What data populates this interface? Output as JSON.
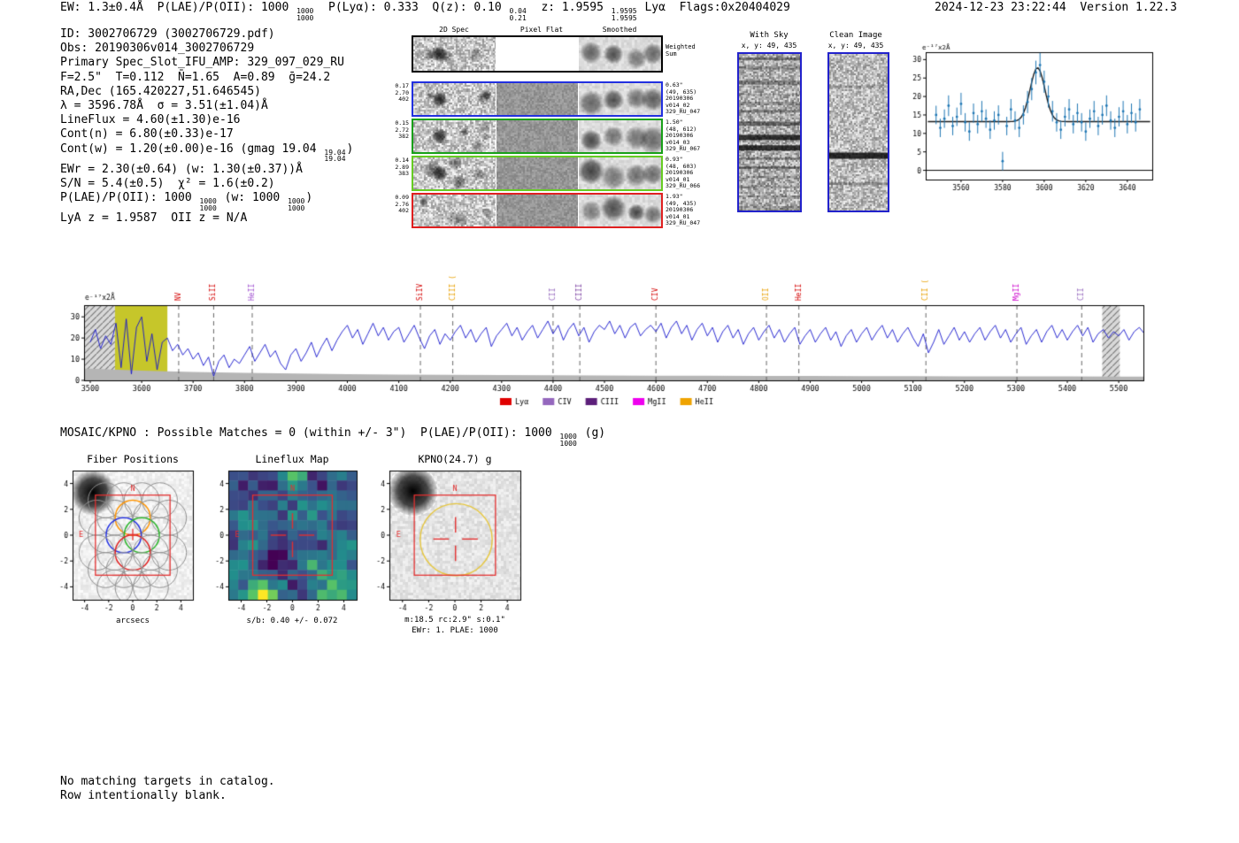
{
  "meta": {
    "timestamp_version": "2024-12-23 23:22:44  Version 1.22.3"
  },
  "header": {
    "segments": [
      {
        "t": "EW: 1.3±0.4Å  P(LAE)/P(OII): 1000 "
      },
      {
        "hi": "1000",
        "lo": "1000"
      },
      {
        "t": "  P(Lyα): 0.333  Q(z): 0.10 "
      },
      {
        "hi": "0.04",
        "lo": "0.21"
      },
      {
        "t": "  z: 1.9595 "
      },
      {
        "hi": "1.9595",
        "lo": "1.9595"
      },
      {
        "t": " Lyα  Flags:0x20404029"
      }
    ]
  },
  "info": {
    "lines": [
      [
        {
          "t": "ID: 3002706729 (3002706729.pdf)"
        }
      ],
      [
        {
          "t": "Obs: 20190306v014_3002706729"
        }
      ],
      [
        {
          "t": "Primary Spec_Slot_IFU_AMP: 329_097_029_RU"
        }
      ],
      [
        {
          "t": "F=2.5\"  T=0.112  N̄=1.65  A=0.89  ḡ=24.2"
        }
      ],
      [
        {
          "t": "RA,Dec (165.420227,51.646545)"
        }
      ],
      [
        {
          "t": "λ = 3596.78Å  σ = 3.51(±1.04)Å"
        }
      ],
      [
        {
          "t": "LineFlux = 4.60(±1.30)e-16"
        }
      ],
      [
        {
          "t": "Cont(n) = 6.80(±0.33)e-17"
        }
      ],
      [
        {
          "t": "Cont(w) = 1.20(±0.00)e-16 (gmag 19.04 "
        },
        {
          "hi": "19.04",
          "lo": "19.04"
        },
        {
          "t": ")"
        }
      ],
      [
        {
          "t": "EWr = 2.30(±0.64) (w: 1.30(±0.37))Å"
        }
      ],
      [
        {
          "t": "S/N = 5.4(±0.5)  χ² = 1.6(±0.2)"
        }
      ],
      [
        {
          "t": "P(LAE)/P(OII): 1000 "
        },
        {
          "hi": "1000",
          "lo": "1000"
        },
        {
          "t": " (w: 1000 "
        },
        {
          "hi": "1000",
          "lo": "1000"
        },
        {
          "t": ")"
        }
      ],
      [
        {
          "t": "LyA z = 1.9587  OII z = N/A"
        }
      ]
    ]
  },
  "cutouts": {
    "col_titles": [
      "2D Spec",
      "Pixel Flat",
      "Smoothed"
    ],
    "weighted_right": [
      "Weighted",
      "Sum"
    ],
    "rows": [
      {
        "left": [
          "0.17",
          "2.70",
          "402"
        ],
        "color": "#2230e0",
        "right": [
          "0.63\"",
          "(49, 635)",
          "20190306",
          "v014_02",
          "329_RU_047"
        ]
      },
      {
        "left": [
          "0.15",
          "2.72",
          "382"
        ],
        "color": "#18a018",
        "right": [
          "1.50\"",
          "(48, 612)",
          "20190306",
          "v014_03",
          "329_RU_067"
        ]
      },
      {
        "left": [
          "0.14",
          "2.89",
          "383"
        ],
        "color": "#66cc22",
        "right": [
          "0.93\"",
          "(48, 603)",
          "20190306",
          "v014_01",
          "329_RU_066"
        ]
      },
      {
        "left": [
          "0.09",
          "2.76",
          "402"
        ],
        "color": "#e02020",
        "right": [
          "1.93\"",
          "(49, 435)",
          "20190306",
          "v014_01",
          "329_RU_047"
        ]
      }
    ]
  },
  "withsky": {
    "title": "With Sky",
    "subtitle": "x, y: 49, 435"
  },
  "clean": {
    "title": "Clean Image",
    "subtitle": "x, y: 49, 435"
  },
  "mosaic": {
    "segments": [
      {
        "t": "MOSAIC/KPNO : Possible Matches = 0 (within +/- 3\")  P(LAE)/P(OII): 1000 "
      },
      {
        "hi": "1000",
        "lo": "1000"
      },
      {
        "t": " (g)"
      }
    ]
  },
  "bottom": {
    "fiber": {
      "title": "Fiber Positions",
      "xlabel": "arcsecs"
    },
    "lineflux": {
      "title": "Lineflux Map",
      "xlabel": "s/b: 0.40 +/- 0.072"
    },
    "kpno": {
      "title": "KPNO(24.7) g",
      "xlabel": "m:18.5 rc:2.9\" s:0.1\"",
      "xlabel2": "EWr: 1. PLAE: 1000"
    }
  },
  "footer": {
    "lines": [
      "No matching targets in catalog.",
      "Row intentionally blank."
    ]
  },
  "chart_data": [
    {
      "id": "emission-line-fit",
      "type": "scatter",
      "title": "",
      "xlabel": "",
      "ylabel": "e⁻¹⁷x2Å",
      "xlim": [
        3543,
        3652
      ],
      "ylim": [
        -2.5,
        32
      ],
      "xticks": [
        3560,
        3580,
        3600,
        3620,
        3640
      ],
      "yticks": [
        0,
        5,
        10,
        15,
        20,
        25,
        30
      ],
      "x0": 3548,
      "dx": 2,
      "y": [
        15,
        11.5,
        14,
        17.5,
        12,
        14.5,
        18,
        13,
        10.5,
        15.5,
        12.5,
        16,
        14,
        11,
        13.5,
        15,
        2.5,
        12,
        16.5,
        13.5,
        11.5,
        15,
        18.5,
        22,
        26.5,
        28.5,
        24,
        20,
        16,
        13,
        11,
        14.5,
        16.5,
        12.5,
        15.5,
        13,
        10.5,
        14,
        16,
        12,
        15,
        17.5,
        13.5,
        11.5,
        14.5,
        16,
        12.5,
        15.5,
        13,
        16.5
      ],
      "yerr": [
        2.5,
        2.5,
        2.5,
        2.8,
        2.5,
        2.5,
        3,
        2.5,
        2.5,
        2.6,
        2.5,
        2.8,
        2.5,
        2.5,
        2.5,
        2.6,
        2.5,
        2.5,
        2.8,
        2.5,
        2.5,
        2.6,
        3,
        3,
        3.2,
        3.3,
        3,
        3,
        2.8,
        2.5,
        2.5,
        2.6,
        2.8,
        2.5,
        2.6,
        2.5,
        2.5,
        2.5,
        2.8,
        2.5,
        2.6,
        2.8,
        2.5,
        2.5,
        2.6,
        2.8,
        2.5,
        2.6,
        2.5,
        2.8
      ],
      "fit": {
        "center": 3596.78,
        "sigma": 3.51,
        "baseline": 13.2,
        "amplitude": 14.6
      },
      "point_color": "#1f77b4",
      "fit_color": "#1a1a1a"
    },
    {
      "id": "full-spectrum",
      "type": "line",
      "ylabel": "e⁻¹⁷x2Å",
      "xlim": [
        3488,
        5548
      ],
      "ylim": [
        0,
        35.5
      ],
      "xticks": [
        3500,
        3600,
        3700,
        3800,
        3900,
        4000,
        4100,
        4200,
        4300,
        4400,
        4500,
        4600,
        4700,
        4800,
        4900,
        5000,
        5100,
        5200,
        5300,
        5400,
        5500
      ],
      "yticks": [
        0,
        10,
        20,
        30
      ],
      "x0": 3500,
      "dx": 10,
      "flux": [
        18,
        24,
        15,
        21,
        17,
        27,
        6,
        29,
        3,
        25,
        30,
        9,
        22,
        5,
        18,
        20,
        14,
        17,
        12,
        15,
        10,
        13,
        7,
        11,
        2,
        9,
        12,
        6,
        10,
        8,
        12,
        16,
        9,
        13,
        17,
        11,
        14,
        8,
        5,
        12,
        15,
        9,
        13,
        18,
        11,
        16,
        20,
        14,
        19,
        23,
        26,
        20,
        24,
        17,
        22,
        27,
        21,
        25,
        19,
        23,
        25,
        18,
        22,
        26,
        20,
        15,
        21,
        24,
        17,
        22,
        19,
        23,
        26,
        20,
        24,
        18,
        22,
        25,
        16,
        21,
        24,
        27,
        21,
        25,
        19,
        23,
        26,
        20,
        24,
        28,
        22,
        26,
        19,
        24,
        27,
        21,
        25,
        18,
        23,
        26,
        24,
        28,
        22,
        26,
        20,
        25,
        27,
        21,
        24,
        26,
        23,
        27,
        20,
        25,
        28,
        22,
        26,
        19,
        24,
        27,
        21,
        25,
        18,
        23,
        26,
        20,
        24,
        17,
        22,
        25,
        19,
        23,
        26,
        20,
        24,
        18,
        22,
        25,
        17,
        21,
        24,
        18,
        22,
        25,
        19,
        23,
        16,
        21,
        24,
        18,
        22,
        25,
        19,
        23,
        26,
        20,
        24,
        18,
        22,
        25,
        20,
        16,
        22,
        13,
        18,
        24,
        17,
        21,
        25,
        19,
        23,
        18,
        22,
        25,
        19,
        23,
        26,
        20,
        24,
        18,
        22,
        25,
        17,
        21,
        24,
        18,
        23,
        26,
        20,
        24,
        19,
        23,
        26,
        21,
        25,
        18,
        22,
        24,
        20,
        23,
        21,
        24,
        19,
        23,
        25,
        22
      ],
      "noise_x0": 3500,
      "noise_dx": 100,
      "noise": [
        5.5,
        4.6,
        4.0,
        3.5,
        3.2,
        2.9,
        2.7,
        2.6,
        2.5,
        2.4,
        2.3,
        2.2,
        2.2,
        2.1,
        2.1,
        2.0,
        2.0,
        1.9,
        1.9,
        1.9,
        1.8
      ],
      "line_color": "#1414cc",
      "noise_color": "#b5b5b5",
      "highlight_band": [
        3548,
        3650
      ],
      "highlight_color": "#c6c62a",
      "edge_bands": [
        [
          3490,
          3548
        ],
        [
          5468,
          5502
        ]
      ],
      "markers": [
        {
          "label": "NV",
          "x": 3672,
          "color": "#d40000"
        },
        {
          "label": "SiII",
          "x": 3740,
          "color": "#d40000"
        },
        {
          "label": "HeII",
          "x": 3815,
          "color": "#a050d0"
        },
        {
          "label": "SiIV",
          "x": 4142,
          "color": "#d40000"
        },
        {
          "label": "CIII (",
          "x": 4205,
          "color": "#e8a000"
        },
        {
          "label": "CII",
          "x": 4400,
          "color": "#9467bd"
        },
        {
          "label": "CIII",
          "x": 4452,
          "color": "#7b3fa0"
        },
        {
          "label": "CIV",
          "x": 4600,
          "color": "#d40000"
        },
        {
          "label": "OII",
          "x": 4815,
          "color": "#e8a000"
        },
        {
          "label": "HeII",
          "x": 4878,
          "color": "#d40000"
        },
        {
          "label": "CII (",
          "x": 5125,
          "color": "#e8a000"
        },
        {
          "label": "MgII",
          "x": 5302,
          "color": "#cc00cc"
        },
        {
          "label": "CII",
          "x": 5428,
          "color": "#9467bd"
        }
      ],
      "legend": [
        {
          "label": "Lyα",
          "color": "#e00000"
        },
        {
          "label": "CIV",
          "color": "#9467bd"
        },
        {
          "label": "CIII",
          "color": "#5c1f7a"
        },
        {
          "label": "MgII",
          "color": "#ee00ee"
        },
        {
          "label": "HeII",
          "color": "#efa300"
        }
      ]
    },
    {
      "id": "fiber-positions",
      "type": "scatter",
      "title": "Fiber Positions",
      "xlabel": "arcsecs",
      "xlim": [
        -5,
        5
      ],
      "ylim": [
        -5,
        5
      ],
      "ticks": [
        -4,
        -2,
        0,
        2,
        4
      ],
      "fiber_radius": 0.73,
      "selection_box": [
        -3.1,
        3.1
      ],
      "compass": {
        "n": "N",
        "e": "E"
      },
      "fibers": [
        {
          "x": -2.25,
          "y": 2.7
        },
        {
          "x": -0.75,
          "y": 2.7
        },
        {
          "x": 0.75,
          "y": 2.7
        },
        {
          "x": 2.25,
          "y": 2.7
        },
        {
          "x": -3,
          "y": 1.35
        },
        {
          "x": -1.5,
          "y": 1.35
        },
        {
          "x": 0,
          "y": 1.35,
          "color": "#ff9400"
        },
        {
          "x": 1.5,
          "y": 1.35
        },
        {
          "x": 3,
          "y": 1.35
        },
        {
          "x": -2.25,
          "y": 0
        },
        {
          "x": -0.75,
          "y": 0,
          "color": "#2230e0"
        },
        {
          "x": 0.75,
          "y": 0,
          "color": "#28b428"
        },
        {
          "x": 2.25,
          "y": 0
        },
        {
          "x": -3,
          "y": -1.35
        },
        {
          "x": -1.5,
          "y": -1.35
        },
        {
          "x": 0,
          "y": -1.35,
          "color": "#e02020"
        },
        {
          "x": 1.5,
          "y": -1.35
        },
        {
          "x": 3,
          "y": -1.35
        },
        {
          "x": -2.25,
          "y": -2.7
        },
        {
          "x": -0.75,
          "y": -2.7
        },
        {
          "x": 0.75,
          "y": -2.7
        },
        {
          "x": 2.25,
          "y": -2.7
        },
        {
          "x": -1.5,
          "y": -4.05
        },
        {
          "x": 0,
          "y": -4.05
        },
        {
          "x": 1.5,
          "y": -4.05
        }
      ]
    },
    {
      "id": "lineflux-map",
      "type": "heatmap",
      "title": "Lineflux Map",
      "xlabel": "s/b: 0.40 +/- 0.072",
      "sb": 0.4,
      "sb_err": 0.072,
      "xlim": [
        -5,
        5
      ],
      "ylim": [
        -5,
        5
      ],
      "ticks": [
        -4,
        -2,
        0,
        2,
        4
      ],
      "compass": {
        "n": "N",
        "e": "E"
      }
    },
    {
      "id": "kpno-g-image",
      "type": "heatmap",
      "title": "KPNO(24.7) g",
      "xlabel": "m:18.5 rc:2.9\" s:0.1\"",
      "xlabel2": "EWr: 1. PLAE: 1000",
      "m": 18.5,
      "rc_arcsec": 2.9,
      "s_arcsec": 0.1,
      "ewr": 1,
      "plae": 1000,
      "aperture_radius": 2.75,
      "xlim": [
        -5,
        5
      ],
      "ylim": [
        -5,
        5
      ],
      "ticks": [
        -4,
        -2,
        0,
        2,
        4
      ],
      "compass": {
        "n": "N",
        "e": "E"
      }
    }
  ]
}
